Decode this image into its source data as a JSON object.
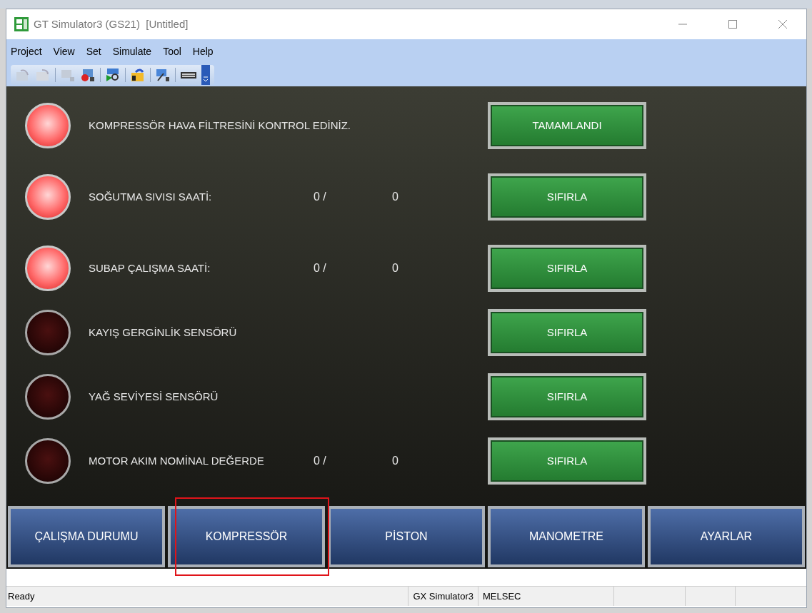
{
  "window": {
    "title": "GT Simulator3 (GS21)  [Untitled]"
  },
  "menu": [
    {
      "label": "Project"
    },
    {
      "label": "View"
    },
    {
      "label": "Set"
    },
    {
      "label": "Simulate"
    },
    {
      "label": "Tool"
    },
    {
      "label": "Help"
    }
  ],
  "rows": [
    {
      "lamp_on": true,
      "label": "KOMPRESSÖR HAVA FİLTRESİNİ KONTROL EDİNİZ.",
      "button": "TAMAMLANDI"
    },
    {
      "lamp_on": true,
      "label": "SOĞUTMA SIVISI SAATİ:",
      "value": "0 /",
      "limit": "0",
      "button": "SIFIRLA"
    },
    {
      "lamp_on": true,
      "label": "SUBAP ÇALIŞMA SAATİ:",
      "value": "0 /",
      "limit": "0",
      "button": "SIFIRLA"
    },
    {
      "lamp_on": false,
      "label": "KAYIŞ GERGİNLİK SENSÖRÜ",
      "button": "SIFIRLA"
    },
    {
      "lamp_on": false,
      "label": "YAĞ SEVİYESİ SENSÖRÜ",
      "button": "SIFIRLA"
    },
    {
      "lamp_on": false,
      "label": "MOTOR AKIM NOMİNAL DEĞERDE",
      "value": "0 /",
      "limit": "0",
      "button": "SIFIRLA"
    }
  ],
  "nav": [
    {
      "label": "ÇALIŞMA DURUMU",
      "highlighted": false
    },
    {
      "label": "KOMPRESSÖR",
      "highlighted": true
    },
    {
      "label": "PİSTON",
      "highlighted": false
    },
    {
      "label": "MANOMETRE",
      "highlighted": false
    },
    {
      "label": "AYARLAR",
      "highlighted": false
    }
  ],
  "status_bar": {
    "text": "Ready",
    "panels": [
      "GX Simulator3",
      "MELSEC"
    ]
  }
}
